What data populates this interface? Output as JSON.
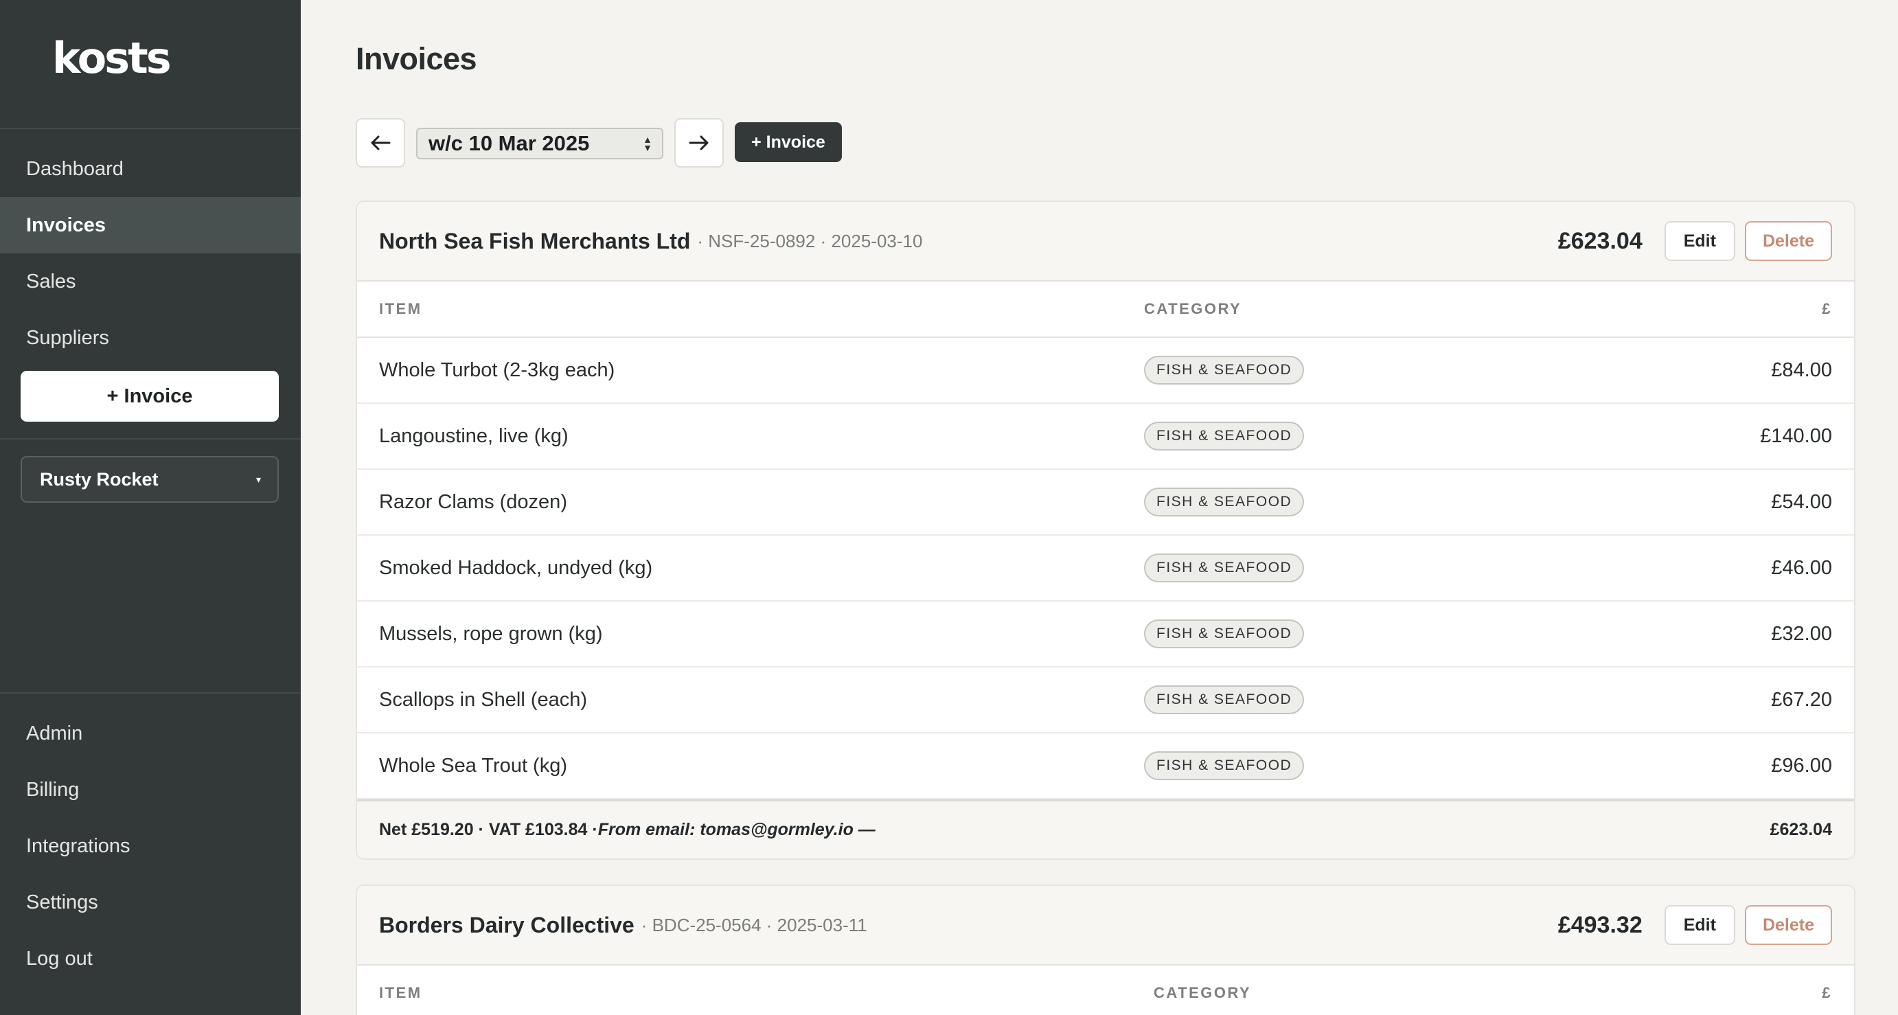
{
  "app": {
    "logo": "kosts"
  },
  "sidebar": {
    "nav": [
      {
        "label": "Dashboard"
      },
      {
        "label": "Invoices",
        "active": true
      },
      {
        "label": "Sales"
      },
      {
        "label": "Suppliers"
      }
    ],
    "invoice_button": "+ Invoice",
    "venue": {
      "selected": "Rusty Rocket"
    },
    "bottom_nav": [
      {
        "label": "Admin"
      },
      {
        "label": "Billing"
      },
      {
        "label": "Integrations"
      },
      {
        "label": "Settings"
      },
      {
        "label": "Log out"
      }
    ]
  },
  "page": {
    "title": "Invoices",
    "week": {
      "selected": "w/c 10 Mar 2025"
    },
    "invoice_button": "+ Invoice"
  },
  "table_headers": {
    "item": "ITEM",
    "category": "CATEGORY",
    "amount": "£"
  },
  "invoices": [
    {
      "supplier": "North Sea Fish Merchants Ltd",
      "meta": "· NSF-25-0892 · 2025-03-10",
      "total": "£623.04",
      "edit_label": "Edit",
      "delete_label": "Delete",
      "items": [
        {
          "name": "Whole Turbot (2-3kg each)",
          "category": "FISH & SEAFOOD",
          "amount": "£84.00"
        },
        {
          "name": "Langoustine, live (kg)",
          "category": "FISH & SEAFOOD",
          "amount": "£140.00"
        },
        {
          "name": "Razor Clams (dozen)",
          "category": "FISH & SEAFOOD",
          "amount": "£54.00"
        },
        {
          "name": "Smoked Haddock, undyed (kg)",
          "category": "FISH & SEAFOOD",
          "amount": "£46.00"
        },
        {
          "name": "Mussels, rope grown (kg)",
          "category": "FISH & SEAFOOD",
          "amount": "£32.00"
        },
        {
          "name": "Scallops in Shell (each)",
          "category": "FISH & SEAFOOD",
          "amount": "£67.20"
        },
        {
          "name": "Whole Sea Trout (kg)",
          "category": "FISH & SEAFOOD",
          "amount": "£96.00"
        }
      ],
      "footer": {
        "summary": "Net £519.20 · VAT £103.84 · ",
        "source": "From email: tomas@gormley.io —",
        "total": "£623.04"
      }
    },
    {
      "supplier": "Borders Dairy Collective",
      "meta": "· BDC-25-0564 · 2025-03-11",
      "total": "£493.32",
      "edit_label": "Edit",
      "delete_label": "Delete"
    }
  ],
  "colors": {
    "sidebar_bg": "#333939",
    "sidebar_active": "#495050",
    "page_bg": "#f4f3ef",
    "delete_accent": "#c48a72"
  }
}
